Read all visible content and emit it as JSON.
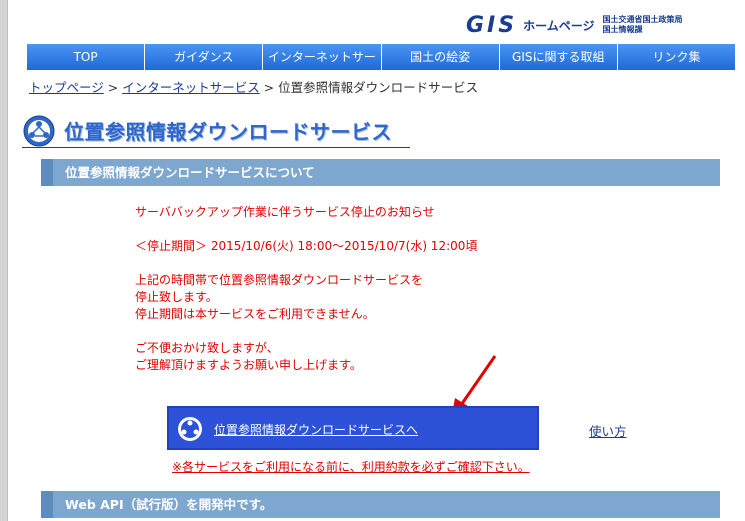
{
  "header": {
    "logo_main": "GIS",
    "logo_home": "ホームページ",
    "logo_org_line1": "国土交通省国土政策局",
    "logo_org_line2": "国土情報課"
  },
  "nav": {
    "items": [
      {
        "label": "TOP"
      },
      {
        "label": "ガイダンス"
      },
      {
        "label": "インターネットサー"
      },
      {
        "label": "国土の絵姿"
      },
      {
        "label": "GISに関する取組"
      },
      {
        "label": "リンク集"
      }
    ]
  },
  "breadcrumb": {
    "home": "トップページ",
    "sep1": " > ",
    "parent": "インターネットサービス",
    "sep2": " > ",
    "current": "位置参照情報ダウンロードサービス"
  },
  "page": {
    "title": "位置参照情報ダウンロードサービス"
  },
  "section1": {
    "header": "位置参照情報ダウンロードサービスについて",
    "notice": {
      "title": "サーババックアップ作業に伴うサービス停止のお知らせ",
      "period": "＜停止期間＞ 2015/10/6(火) 18:00〜2015/10/7(水) 12:00頃",
      "line1": "上記の時間帯で位置参照情報ダウンロードサービスを",
      "line2": "停止致します。",
      "line3": "停止期間は本サービスをご利用できません。",
      "line4": "ご不便おかけ致しますが、",
      "line5": "ご理解頂けますようお願い申し上げます。"
    },
    "download_button": "位置参照情報ダウンロードサービスへ",
    "usage_link": "使い方",
    "terms_link": "※各サービスをご利用になる前に、利用約款を必ずご確認下さい。"
  },
  "section2": {
    "header": "Web API（試行版）を開発中です。"
  },
  "colors": {
    "nav_blue": "#2f7be6",
    "section_header": "#7ea7cf",
    "notice_red": "#e30000",
    "button_blue": "#2d52d8",
    "link_navy": "#1a3d91"
  }
}
